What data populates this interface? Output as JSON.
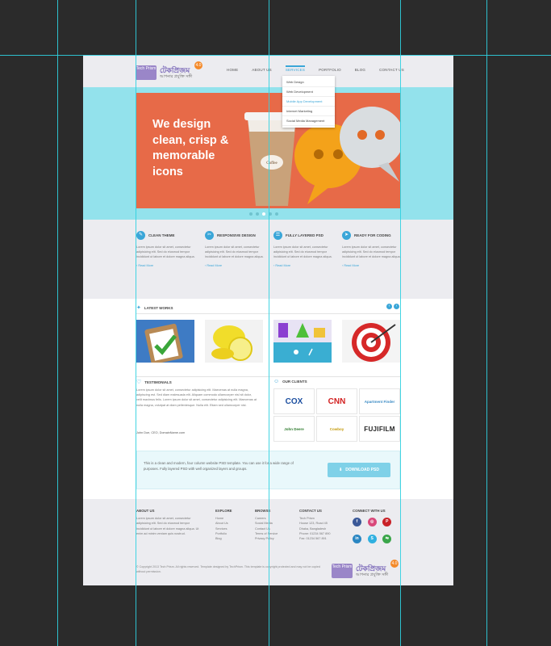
{
  "header": {
    "logo_box": "Tech Prism",
    "logo_main": "টেকপ্রিজম",
    "logo_sub": "আপনার প্রযুক্তি সঙ্গী",
    "badge": "4.0",
    "nav": [
      "HOME",
      "ABOUT US",
      "SERVICES",
      "PORTFOLIO",
      "BLOG",
      "CONTACT US"
    ],
    "dropdown": [
      "Web Design",
      "Web Development",
      "Mobile App Development",
      "Internet Marketing",
      "Social Media Management"
    ]
  },
  "hero": {
    "line1": "We design",
    "line2": "clean, crisp &",
    "line3": "memorable",
    "line4": "icons",
    "cup_label": "Coffee",
    "slides": 5,
    "active_slide": 3
  },
  "features": [
    {
      "icon": "✎",
      "title": "CLEAN THEME",
      "text": "Lorem ipsum dolor sit amet, consectetur adipisicing elit. Sed do eiusmod tempor incididunt ut labore et dolore magna aliqua.",
      "more": "Read More"
    },
    {
      "icon": "✂",
      "title": "RESPONSIVE DESIGN",
      "text": "Lorem ipsum dolor sit amet, consectetur adipisicing elit. Sed do eiusmod tempor incididunt ut labore et dolore magna aliqua.",
      "more": "Read More"
    },
    {
      "icon": "☰",
      "title": "FULLY LAYERED PSD",
      "text": "Lorem ipsum dolor sit amet, consectetur adipisicing elit. Sed do eiusmod tempor incididunt ut labore et dolore magna aliqua.",
      "more": "Read More"
    },
    {
      "icon": "➤",
      "title": "READY FOR CODING",
      "text": "Lorem ipsum dolor sit amet, consectetur adipisicing elit. Sed do eiusmod tempor incididunt ut labore et dolore magna aliqua.",
      "more": "Read More"
    }
  ],
  "latest": {
    "title": "LATEST WORKS",
    "prev": "‹",
    "next": "›"
  },
  "testimonials": {
    "title": "TESTIMONIALS",
    "text": "Lorem ipsum dolor sit amet, consectetur adipisicing elit. Maecenas at nulla magna, adipiscing est. Sed diam malesuada elit. Aliquam commodo ullamcorper nisl sit dolor, velit maximus felis. Lorem ipsum dolor sit amet, consectetur adipisicing elit. Maecenas at nulla magna, volutpat at diam pellentesque. Nulla elit. Etiam sed ullamcorper nisl.",
    "author": "John Doe, CEO, DomainName.com"
  },
  "clients": {
    "title": "OUR CLIENTS",
    "logos": [
      "COX",
      "CNN",
      "Apartment Finder",
      "John Deere",
      "Cowboy",
      "FUJIFILM"
    ]
  },
  "cta": {
    "text": "This is a clean and modern, four column website PSD template. You can use it for a wide range of purposes. Fully layered PSD with well organized layers and groups.",
    "button": "DOWNLOAD PSD"
  },
  "footer": {
    "about_title": "ABOUT US",
    "about_text": "Lorem ipsum dolor sit amet, consectetur adipisicing elit. Sed do eiusmod tempor incididunt ut labore et dolore magna aliqua. Ut enim ad minim veniam quis nostrud.",
    "explore_title": "EXPLORE",
    "explore": [
      "Home",
      "About Us",
      "Services",
      "Portfolio",
      "Blog"
    ],
    "browse_title": "BROWSE",
    "browse": [
      "Careers",
      "Social Media",
      "Contact Us",
      "Terms of Service",
      "Privacy Policy"
    ],
    "contact_title": "CONTACT US",
    "contact": [
      "Tech Prism",
      "House 123, Road 45",
      "Dhaka, Bangladesh",
      "Phone: 01234 567 890",
      "Fax: 01234 567 891"
    ],
    "connect_title": "CONNECT WITH US",
    "social": [
      "f",
      "◎",
      "P",
      "in",
      "S",
      "⇆"
    ],
    "copyright": "© Copyright 2013 Tech Prism. All rights reserved. Template designed by TechPrism. This template is copyright protected and may not be copied without permission."
  }
}
